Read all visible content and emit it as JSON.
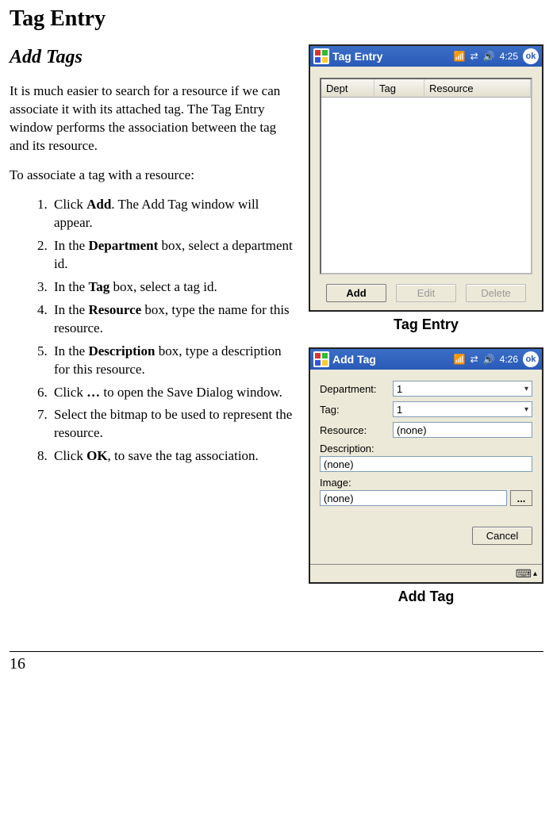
{
  "page": {
    "title": "Tag Entry",
    "section": "Add Tags",
    "intro": "It is much easier to search for a resource if we can associate it with its attached tag.  The Tag Entry window performs the association between the tag and its resource.",
    "lead": "To associate a tag with a resource:",
    "steps": [
      {
        "pre": "Click ",
        "b": "Add",
        "post": ".  The Add Tag window will appear."
      },
      {
        "pre": "In the ",
        "b": "Department",
        "post": " box, select a department id."
      },
      {
        "pre": "In the ",
        "b": "Tag",
        "post": " box, select a tag id."
      },
      {
        "pre": "In the ",
        "b": "Resource",
        "post": " box, type the name for this resource."
      },
      {
        "pre": "In the ",
        "b": "Description",
        "post": " box, type a description for this resource."
      },
      {
        "pre": "Click ",
        "b": "…",
        "post": " to open the Save Dialog window."
      },
      {
        "pre": "Select the bitmap to be used to represent the resource.",
        "b": "",
        "post": ""
      },
      {
        "pre": "Click ",
        "b": "OK",
        "post": ", to save the tag association."
      }
    ],
    "footer_page": "16"
  },
  "tagEntryWindow": {
    "title": "Tag Entry",
    "time": "4:25",
    "columns": {
      "dept": "Dept",
      "tag": "Tag",
      "resource": "Resource"
    },
    "buttons": {
      "add": "Add",
      "edit": "Edit",
      "delete": "Delete"
    },
    "caption": "Tag Entry",
    "ok": "ok"
  },
  "addTagWindow": {
    "title": "Add Tag",
    "time": "4:26",
    "labels": {
      "dept": "Department:",
      "tag": "Tag:",
      "resource": "Resource:",
      "desc": "Description:",
      "image": "Image:"
    },
    "values": {
      "dept": "1",
      "tag": "1",
      "resource": "(none)",
      "desc": "(none)",
      "image": "(none)"
    },
    "ellipsis": "...",
    "cancel": "Cancel",
    "caption": "Add Tag",
    "ok": "ok"
  }
}
